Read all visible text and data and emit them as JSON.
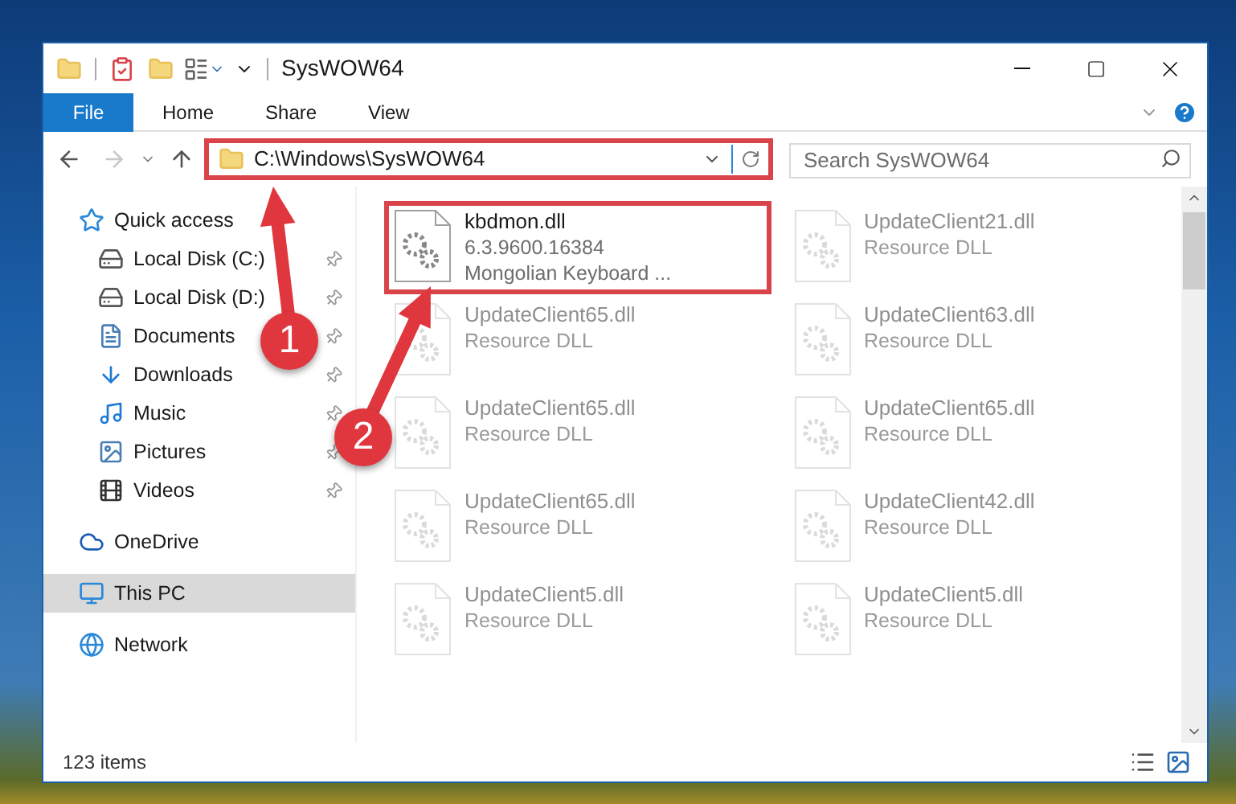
{
  "window": {
    "title": "SysWOW64"
  },
  "ribbon_tabs": [
    {
      "label": "File",
      "selected": true
    },
    {
      "label": "Home",
      "selected": false
    },
    {
      "label": "Share",
      "selected": false
    },
    {
      "label": "View",
      "selected": false
    }
  ],
  "address_bar": {
    "path": "C:\\Windows\\SysWOW64",
    "highlighted": true
  },
  "search": {
    "placeholder": "Search SysWOW64"
  },
  "nav_pane": [
    {
      "label": "Quick access",
      "kind": "star",
      "selected": false,
      "children": [
        {
          "label": "Local Disk (C:)",
          "kind": "drive-c",
          "pinned": true
        },
        {
          "label": "Local Disk (D:)",
          "kind": "drive",
          "pinned": true
        },
        {
          "label": "Documents",
          "kind": "documents",
          "pinned": true
        },
        {
          "label": "Downloads",
          "kind": "downloads",
          "pinned": true
        },
        {
          "label": "Music",
          "kind": "music",
          "pinned": true
        },
        {
          "label": "Pictures",
          "kind": "pictures",
          "pinned": true
        },
        {
          "label": "Videos",
          "kind": "videos",
          "pinned": true
        }
      ]
    },
    {
      "label": "OneDrive",
      "kind": "cloud",
      "selected": false
    },
    {
      "label": "This PC",
      "kind": "pc",
      "selected": true
    },
    {
      "label": "Network",
      "kind": "network",
      "selected": false
    }
  ],
  "files": [
    {
      "name": "kbdmon.dll",
      "details": [
        "6.3.9600.16384",
        "Mongolian Keyboard ..."
      ],
      "highlighted": true,
      "faded": false
    },
    {
      "name": "UpdateClient21.dll",
      "details": [
        "Resource DLL"
      ],
      "highlighted": false,
      "faded": true
    },
    {
      "name": "UpdateClient65.dll",
      "details": [
        "Resource DLL"
      ],
      "highlighted": false,
      "faded": true
    },
    {
      "name": "UpdateClient63.dll",
      "details": [
        "Resource DLL"
      ],
      "highlighted": false,
      "faded": true
    },
    {
      "name": "UpdateClient65.dll",
      "details": [
        "Resource DLL"
      ],
      "highlighted": false,
      "faded": true
    },
    {
      "name": "UpdateClient65.dll",
      "details": [
        "Resource DLL"
      ],
      "highlighted": false,
      "faded": true
    },
    {
      "name": "UpdateClient65.dll",
      "details": [
        "Resource DLL"
      ],
      "highlighted": false,
      "faded": true
    },
    {
      "name": "UpdateClient42.dll",
      "details": [
        "Resource DLL"
      ],
      "highlighted": false,
      "faded": true
    },
    {
      "name": "UpdateClient5.dll",
      "details": [
        "Resource DLL"
      ],
      "highlighted": false,
      "faded": true
    },
    {
      "name": "UpdateClient5.dll",
      "details": [
        "Resource DLL"
      ],
      "highlighted": false,
      "faded": true
    }
  ],
  "callouts": [
    {
      "label": "1"
    },
    {
      "label": "2"
    }
  ],
  "status_bar": {
    "item_count": "123 items"
  }
}
